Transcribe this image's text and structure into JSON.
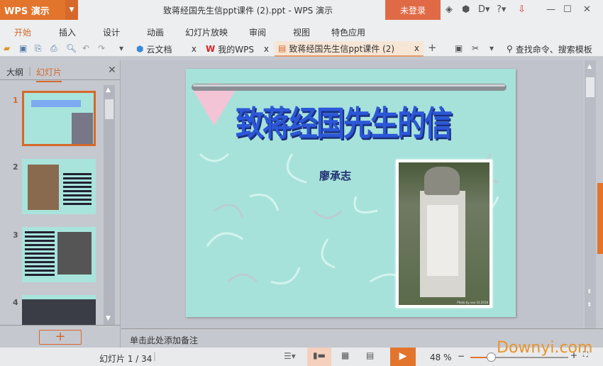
{
  "app": {
    "name": "WPS 演示",
    "title": "致蒋经国先生信ppt课件 (2).ppt - WPS 演示",
    "login": "未登录"
  },
  "menu": [
    "开始",
    "插入",
    "设计",
    "动画",
    "幻灯片放映",
    "审阅",
    "视图",
    "特色应用"
  ],
  "tabs": [
    {
      "label": "云文档"
    },
    {
      "label": "我的WPS"
    },
    {
      "label": "致蒋经国先生信ppt课件 (2)"
    }
  ],
  "search": "查找命令、搜索模板",
  "panel": {
    "outline": "大纲",
    "slides": "幻灯片",
    "numbers": [
      "1",
      "2",
      "3",
      "4"
    ]
  },
  "slide": {
    "title": "致蒋经国先生的信",
    "author": "廖承志",
    "caption": "Photo by xxx 10.2018"
  },
  "notes": "单击此处添加备注",
  "status": {
    "slide": "幻灯片 1 / 34",
    "zoom": "48 %",
    "zoom_value": 48
  },
  "watermark": "Downyi.com",
  "colors": {
    "accent": "#e2742c",
    "slide_bg": "#a6e2da",
    "title": "#2c57d8"
  }
}
